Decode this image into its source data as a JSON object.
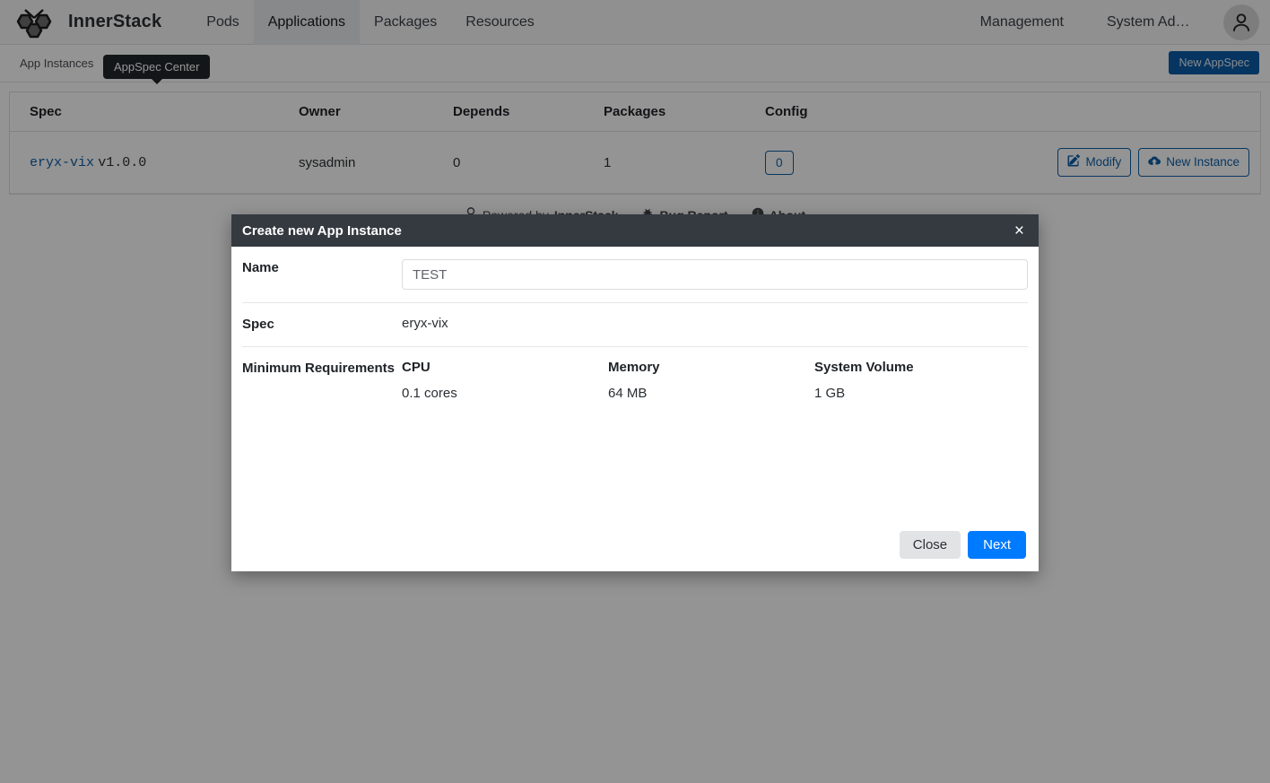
{
  "navbar": {
    "logo_icon": "bee-hexagon-logo-icon",
    "brand": "InnerStack",
    "links": [
      {
        "label": "Pods",
        "active": false
      },
      {
        "label": "Applications",
        "active": true
      },
      {
        "label": "Packages",
        "active": false
      },
      {
        "label": "Resources",
        "active": false
      }
    ],
    "right_links": [
      {
        "label": "Management"
      },
      {
        "label": "System Admin…"
      }
    ],
    "avatar_icon": "user-avatar-icon"
  },
  "subbar": {
    "tabs": [
      {
        "label": "App Instances"
      }
    ],
    "tooltip": "AppSpec Center",
    "new_appspec_label": "New AppSpec"
  },
  "table": {
    "headers": [
      "Spec",
      "Owner",
      "Depends",
      "Packages",
      "Config",
      ""
    ],
    "rows": [
      {
        "spec_name": "eryx-vix",
        "spec_version": "v1.0.0",
        "owner": "sysadmin",
        "depends": "0",
        "packages": "1",
        "config": "0",
        "actions": [
          {
            "label": "Modify",
            "icon": "edit-pencil-square-icon"
          },
          {
            "label": "New Instance",
            "icon": "cloud-upload-icon"
          }
        ]
      }
    ]
  },
  "page_footer": {
    "powered_prefix": "Powered by ",
    "powered_brand": "InnerStack",
    "powered_icon": "award-medal-icon",
    "bug_report": "Bug Report",
    "bug_icon": "bug-icon",
    "about": "About",
    "about_icon": "info-circle-icon"
  },
  "modal": {
    "title": "Create new App Instance",
    "close_icon": "×",
    "name_label": "Name",
    "name_value": "TEST",
    "name_placeholder": "TEST",
    "spec_label": "Spec",
    "spec_value": "eryx-vix",
    "requirements_label": "Minimum Requirements",
    "requirements": [
      {
        "head": "CPU",
        "value": "0.1 cores"
      },
      {
        "head": "Memory",
        "value": "64 MB"
      },
      {
        "head": "System Volume",
        "value": "1 GB"
      }
    ],
    "close_label": "Close",
    "next_label": "Next"
  },
  "colors": {
    "brand_blue": "#0d5fa8",
    "primary_blue": "#007bff",
    "modal_header": "#343a40",
    "tooltip_bg": "#22262a"
  }
}
